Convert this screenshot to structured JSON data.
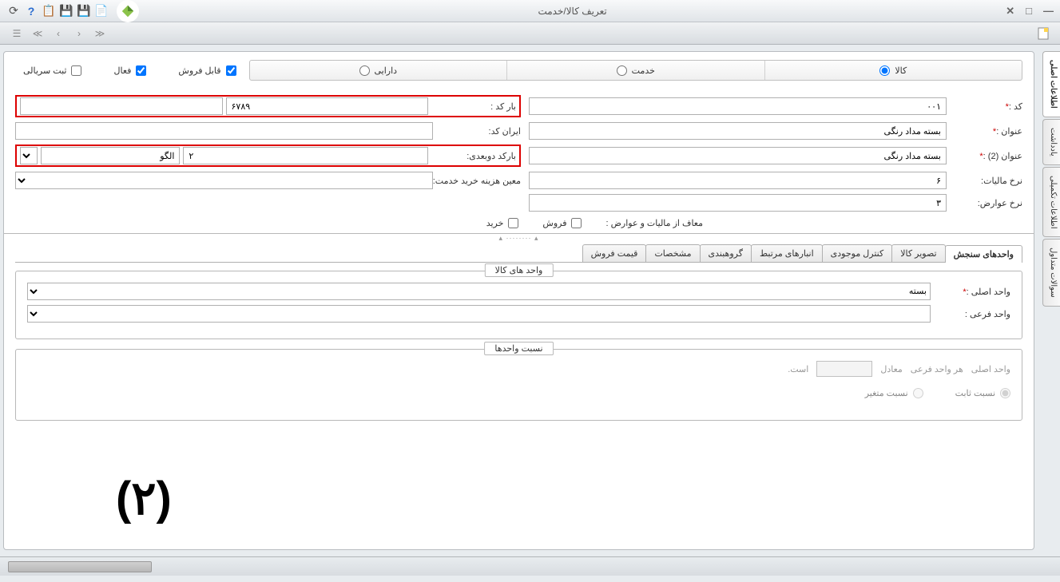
{
  "window": {
    "title": "تعریف کالا/خدمت"
  },
  "toolbar_icons": {
    "help": "؟",
    "save": "💾",
    "save2": "💾",
    "new": "📄",
    "refresh": "🔄"
  },
  "side_tabs": [
    "اطلاعات اصلی",
    "یادداشت",
    "اطلاعات تکمیلی",
    "سوالات متداول"
  ],
  "type_radios": {
    "goods": "کالا",
    "service": "خدمت",
    "asset": "دارایی"
  },
  "checks": {
    "sellable": "قابل فروش",
    "active": "فعال",
    "serial": "ثبت سریالی"
  },
  "form": {
    "code_label": "کد :",
    "code_value": "۰۰۱",
    "barcode_label": "بار کد :",
    "barcode_value": "۶۷۸۹",
    "title_label": "عنوان :",
    "title_value": "بسته مداد رنگی",
    "iran_code_label": "ایران کد:",
    "iran_code_value": "",
    "title2_label": "عنوان (2) :",
    "title2_value": "بسته مداد رنگی",
    "barcode2d_label": "بارکد دوبعدی:",
    "barcode2d_num": "۲",
    "barcode2d_tpl": "الگو",
    "tax_label": "نرخ مالیات:",
    "tax_value": "۶",
    "moein_label": "معین هزینه خرید خدمت:",
    "duty_label": "نرخ عوارض:",
    "duty_value": "۳",
    "exempt_label": "معاف از مالیات و عوارض :",
    "exempt_sale": "فروش",
    "exempt_buy": "خرید"
  },
  "inner_tabs": [
    "واحدهای سنجش",
    "تصویر کالا",
    "کنترل موجودی",
    "انبارهای مرتبط",
    "گروهبندی",
    "مشخصات",
    "قیمت فروش"
  ],
  "fieldsets": {
    "units_legend": "واحد های کالا",
    "main_unit_label": "واحد اصلی :",
    "main_unit_value": "بسته",
    "sub_unit_label": "واحد فرعی :",
    "sub_unit_value": "",
    "ratio_legend": "نسبت واحدها",
    "ratio_text_1": "واحد اصلی",
    "ratio_text_2": "هر واحد فرعی",
    "ratio_text_3": "معادل",
    "ratio_text_4": "است.",
    "fixed_ratio": "نسبت ثابت",
    "var_ratio": "نسبت متغیر"
  },
  "annotation": "(۲)"
}
